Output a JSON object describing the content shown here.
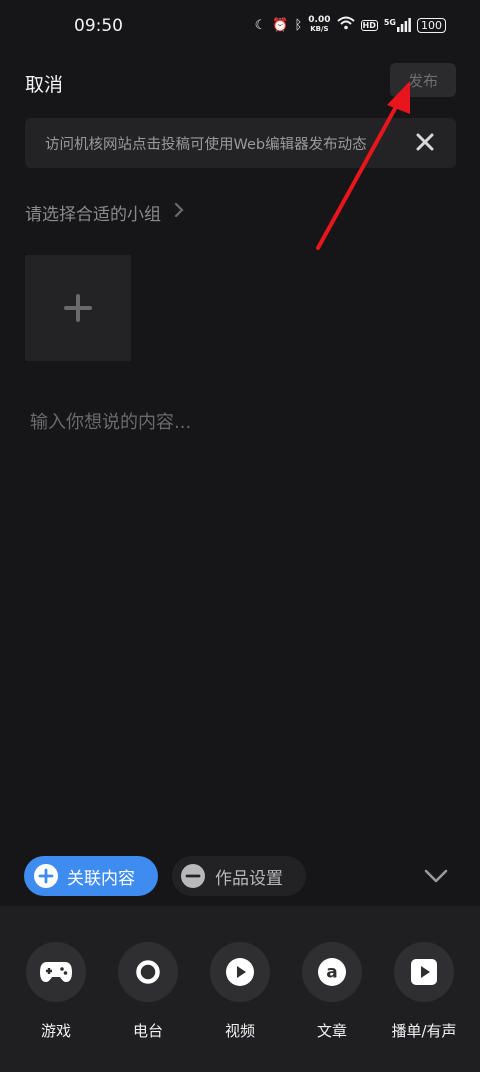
{
  "status_bar": {
    "time": "09:50",
    "net_speed": "0.00",
    "net_unit": "KB/S",
    "hd": "HD",
    "signal": "5G",
    "battery": "100"
  },
  "header": {
    "cancel_label": "取消",
    "publish_label": "发布"
  },
  "banner": {
    "text": "访问机核网站点击投稿可使用Web编辑器发布动态"
  },
  "group": {
    "label": "请选择合适的小组"
  },
  "editor": {
    "placeholder": "输入你想说的内容..."
  },
  "actions": {
    "link_label": "关联内容",
    "works_label": "作品设置"
  },
  "tools": [
    {
      "label": "游戏",
      "icon": "gamepad-icon"
    },
    {
      "label": "电台",
      "icon": "radio-icon"
    },
    {
      "label": "视频",
      "icon": "video-play-icon"
    },
    {
      "label": "文章",
      "icon": "article-a-icon"
    },
    {
      "label": "播单/有声",
      "icon": "playlist-icon"
    }
  ],
  "colors": {
    "background": "#161618",
    "accent": "#3f8cf0",
    "annotation_arrow": "#e8161c"
  }
}
